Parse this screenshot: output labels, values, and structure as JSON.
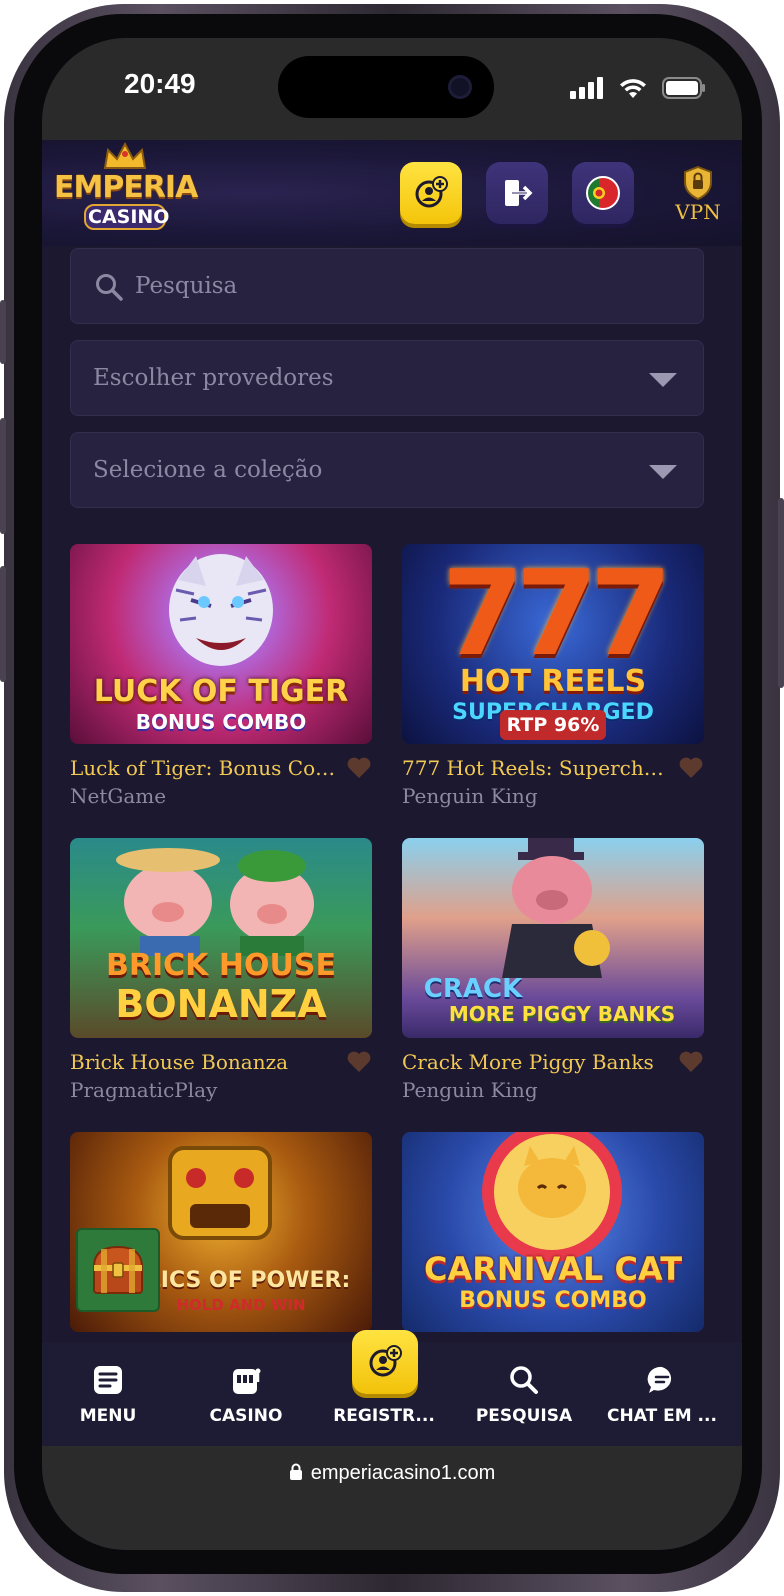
{
  "status_bar": {
    "time": "20:49"
  },
  "header": {
    "logo_line1": "EMPERIA",
    "logo_line2": "CASINO",
    "vpn_label": "VPN"
  },
  "filters": {
    "search_placeholder": "Pesquisa",
    "providers_label": "Escolher provedores",
    "collection_label": "Selecione a coleção"
  },
  "games": [
    {
      "title": "Luck of Tiger: Bonus Combo",
      "provider": "NetGame",
      "art_line1": "LUCK OF TIGER",
      "art_line2": "BONUS COMBO"
    },
    {
      "title": "777 Hot Reels: Supercharged",
      "provider": "Penguin King",
      "art_line1": "777",
      "art_line2": "HOT REELS",
      "art_line3": "SUPERCHARGED",
      "badge": "RTP 96%"
    },
    {
      "title": "Brick House Bonanza",
      "provider": "PragmaticPlay",
      "art_line1": "BRICK HOUSE",
      "art_line2": "BONANZA"
    },
    {
      "title": "Crack More Piggy Banks",
      "provider": "Penguin King",
      "art_line1": "CRACK",
      "art_line2": "MORE PIGGY BANKS"
    },
    {
      "title": "Relics of Power: Hold and Win",
      "provider": "",
      "art_line1": "ELICS OF POWER:",
      "art_line2": "HOLD AND WIN"
    },
    {
      "title": "Carnival Cat: Bonus Combo",
      "provider": "",
      "art_line1": "CARNIVAL CAT",
      "art_line2": "BONUS COMBO"
    }
  ],
  "bottom_nav": {
    "menu": "MENU",
    "casino": "CASINO",
    "register": "REGISTR...",
    "search": "PESQUISA",
    "chat": "CHAT EM ..."
  },
  "browser": {
    "url": "emperiacasino1.com"
  }
}
